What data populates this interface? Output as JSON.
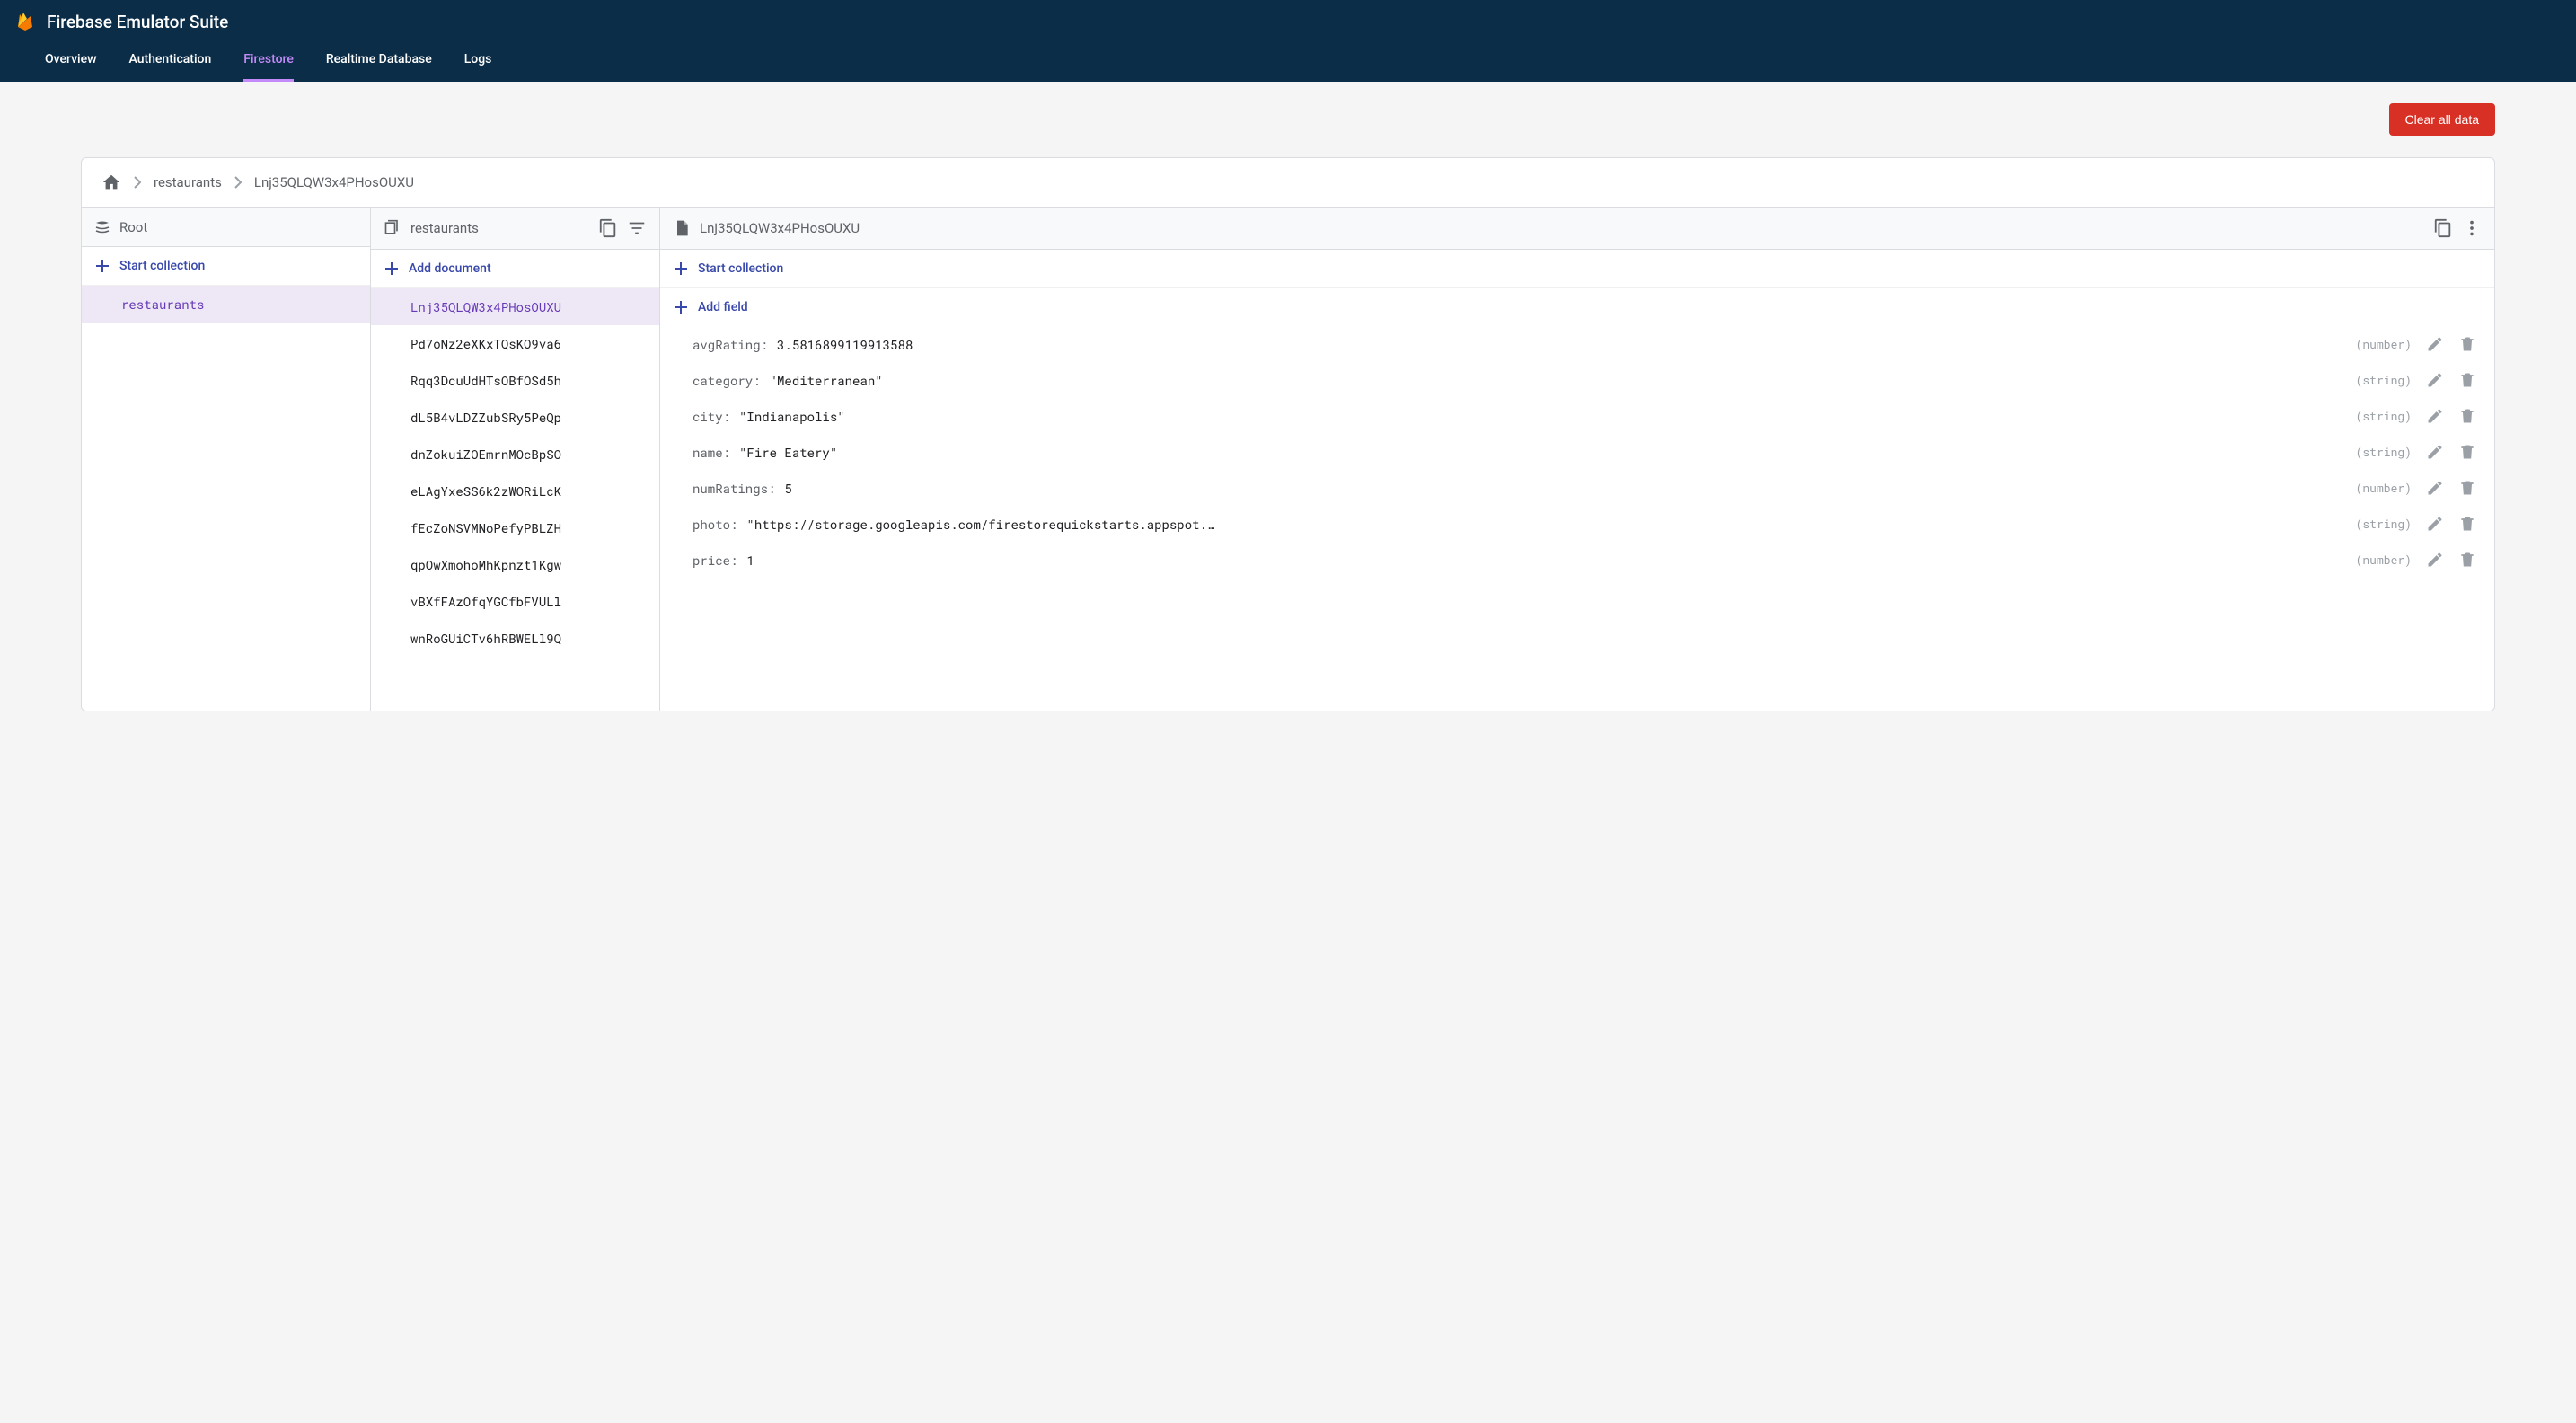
{
  "header": {
    "title": "Firebase Emulator Suite",
    "tabs": [
      {
        "label": "Overview",
        "active": false
      },
      {
        "label": "Authentication",
        "active": false
      },
      {
        "label": "Firestore",
        "active": true
      },
      {
        "label": "Realtime Database",
        "active": false
      },
      {
        "label": "Logs",
        "active": false
      }
    ]
  },
  "toolbar": {
    "clear_label": "Clear all data"
  },
  "breadcrumb": {
    "items": [
      "restaurants",
      "Lnj35QLQW3x4PHosOUXU"
    ]
  },
  "col1": {
    "header_label": "Root",
    "action_label": "Start collection",
    "items": [
      {
        "label": "restaurants",
        "selected": true
      }
    ]
  },
  "col2": {
    "header_label": "restaurants",
    "action_label": "Add document",
    "items": [
      {
        "label": "Lnj35QLQW3x4PHosOUXU",
        "selected": true
      },
      {
        "label": "Pd7oNz2eXKxTQsKO9va6",
        "selected": false
      },
      {
        "label": "Rqq3DcuUdHTsOBfOSd5h",
        "selected": false
      },
      {
        "label": "dL5B4vLDZZubSRy5PeQp",
        "selected": false
      },
      {
        "label": "dnZokuiZOEmrnMOcBpSO",
        "selected": false
      },
      {
        "label": "eLAgYxeSS6k2zWORiLcK",
        "selected": false
      },
      {
        "label": "fEcZoNSVMNoPefyPBLZH",
        "selected": false
      },
      {
        "label": "qpOwXmohoMhKpnzt1Kgw",
        "selected": false
      },
      {
        "label": "vBXfFAzOfqYGCfbFVULl",
        "selected": false
      },
      {
        "label": "wnRoGUiCTv6hRBWELl9Q",
        "selected": false
      }
    ]
  },
  "col3": {
    "header_label": "Lnj35QLQW3x4PHosOUXU",
    "action1_label": "Start collection",
    "action2_label": "Add field",
    "fields": [
      {
        "key": "avgRating",
        "value": "3.5816899119913588",
        "type": "(number)"
      },
      {
        "key": "category",
        "value": "\"Mediterranean\"",
        "type": "(string)"
      },
      {
        "key": "city",
        "value": "\"Indianapolis\"",
        "type": "(string)"
      },
      {
        "key": "name",
        "value": "\"Fire Eatery\"",
        "type": "(string)"
      },
      {
        "key": "numRatings",
        "value": "5",
        "type": "(number)"
      },
      {
        "key": "photo",
        "value": "\"https://storage.googleapis.com/firestorequickstarts.appspot.…",
        "type": "(string)"
      },
      {
        "key": "price",
        "value": "1",
        "type": "(number)"
      }
    ]
  }
}
